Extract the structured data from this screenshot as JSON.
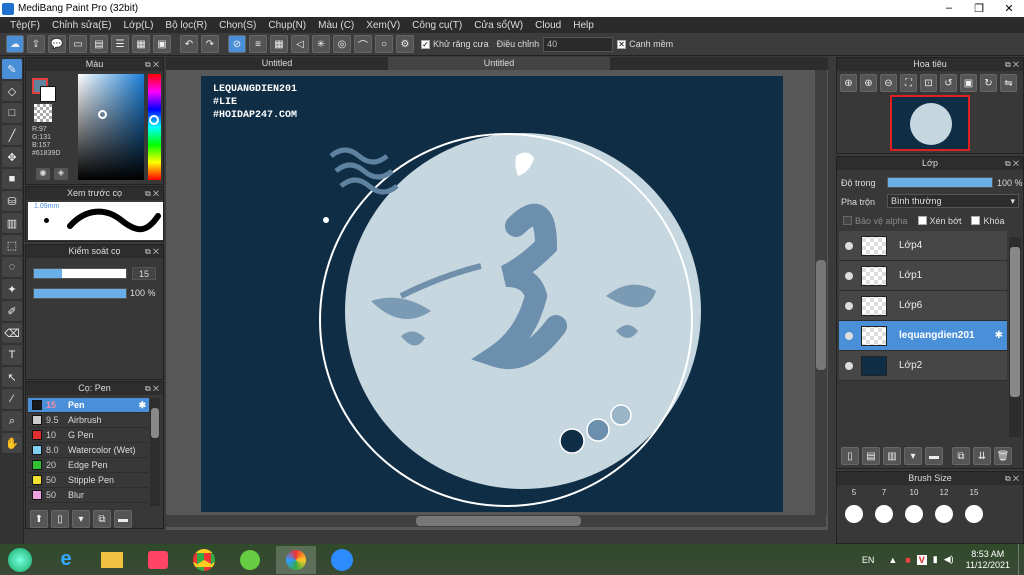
{
  "window": {
    "title": "MediBang Paint Pro (32bit)",
    "minimize": "–",
    "restore": "❐",
    "close": "✕"
  },
  "menu": [
    "Tệp(F)",
    "Chỉnh sửa(E)",
    "Lớp(L)",
    "Bộ lọc(R)",
    "Chọn(S)",
    "Chụp(N)",
    "Màu (C)",
    "Xem(V)",
    "Công cụ(T)",
    "Cửa sổ(W)",
    "Cloud",
    "Help"
  ],
  "toolbar": {
    "antialias_label": "Khử răng cưa",
    "adjust_label": "Điều chỉnh",
    "adjust_value": "40",
    "edge_label": "Cạnh mềm"
  },
  "color_panel": {
    "title": "Màu",
    "r": "R:97",
    "g": "G:131",
    "b": "B:157",
    "hex": "#61839D",
    "primary_color": "#61839D"
  },
  "preview_panel": {
    "title": "Xem trước cọ",
    "size": "1.09mm"
  },
  "brush_control": {
    "title": "Kiểm soát cọ",
    "size_value": "15",
    "opacity_value": "100 %"
  },
  "brush_panel": {
    "title": "Cọ: Pen",
    "brushes": [
      {
        "size": "15",
        "name": "Pen",
        "color": "#1a1a1a"
      },
      {
        "size": "9.5",
        "name": "Airbrush",
        "color": "#cccccc"
      },
      {
        "size": "10",
        "name": "G Pen",
        "color": "#e03030"
      },
      {
        "size": "8.0",
        "name": "Watercolor (Wet)",
        "color": "#7fd0f0"
      },
      {
        "size": "20",
        "name": "Edge Pen",
        "color": "#30c030"
      },
      {
        "size": "50",
        "name": "Stipple Pen",
        "color": "#f0e030"
      },
      {
        "size": "50",
        "name": "Blur",
        "color": "#f0a0e0"
      }
    ]
  },
  "tabs": [
    "Untitled",
    "Untitled"
  ],
  "artwork": {
    "watermark_lines": [
      "LEQUANGDIEN201",
      "#LIE",
      "#HOIDAP247.COM"
    ]
  },
  "navigator": {
    "title": "Hoa tiêu"
  },
  "layers_panel": {
    "title": "Lớp",
    "opacity_label": "Độ trong",
    "opacity_value": "100 %",
    "blend_label": "Pha trộn",
    "blend_value": "Bình thường",
    "protect_alpha": "Bảo vệ alpha",
    "clipping": "Xén bớt",
    "lock": "Khóa",
    "layers": [
      {
        "name": "Lớp4",
        "selected": false
      },
      {
        "name": "Lớp1",
        "selected": false
      },
      {
        "name": "Lớp6",
        "selected": false
      },
      {
        "name": "lequangdien201",
        "selected": true
      },
      {
        "name": "Lớp2",
        "selected": false
      }
    ]
  },
  "brush_size_panel": {
    "title": "Brush Size",
    "sizes": [
      "5",
      "7",
      "10",
      "12",
      "15"
    ]
  },
  "taskbar": {
    "lang": "EN",
    "time": "8:53 AM",
    "date": "11/12/2021"
  }
}
